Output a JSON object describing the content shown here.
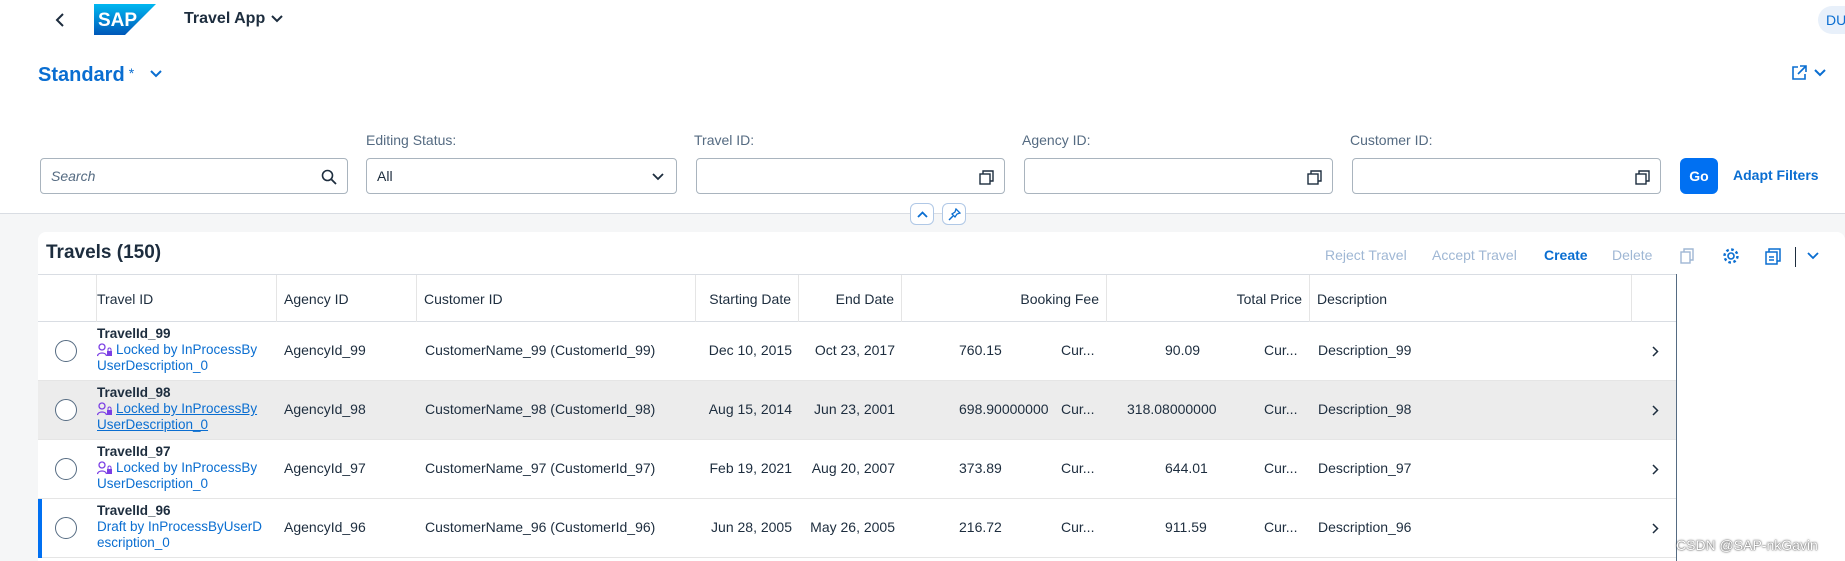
{
  "shell": {
    "app_title": "Travel App",
    "avatar_initials": "DU"
  },
  "header": {
    "variant_name": "Standard",
    "variant_modified": "*"
  },
  "filters": {
    "search_placeholder": "Search",
    "editing_status_label": "Editing Status:",
    "editing_status_value": "All",
    "travel_id_label": "Travel ID:",
    "agency_id_label": "Agency ID:",
    "customer_id_label": "Customer ID:",
    "go_label": "Go",
    "adapt_label": "Adapt Filters"
  },
  "table": {
    "title": "Travels (150)",
    "toolbar": {
      "reject": "Reject Travel",
      "accept": "Accept Travel",
      "create": "Create",
      "delete": "Delete"
    },
    "columns": [
      "Travel ID",
      "Agency ID",
      "Customer ID",
      "Starting Date",
      "End Date",
      "Booking Fee",
      "Total Price",
      "Description"
    ],
    "rows": [
      {
        "travel_id": "TravelId_99",
        "status_line1": "Locked by InProcessBy",
        "status_line2": "UserDescription_0",
        "agency": "AgencyId_99",
        "customer": "CustomerName_99 (CustomerId_99)",
        "start": "Dec 10, 2015",
        "end": "Oct 23, 2017",
        "fee": "760.15",
        "fee_cur": "Cur...",
        "total": "90.09",
        "total_cur": "Cur...",
        "description": "Description_99"
      },
      {
        "travel_id": "TravelId_98",
        "status_line1": "Locked by InProcessBy",
        "status_line2": "UserDescription_0",
        "agency": "AgencyId_98",
        "customer": "CustomerName_98 (CustomerId_98)",
        "start": "Aug 15, 2014",
        "end": "Jun 23, 2001",
        "fee": "698.90000000",
        "fee_cur": "Cur...",
        "total": "318.08000000",
        "total_cur": "Cur...",
        "description": "Description_98"
      },
      {
        "travel_id": "TravelId_97",
        "status_line1": "Locked by InProcessBy",
        "status_line2": "UserDescription_0",
        "agency": "AgencyId_97",
        "customer": "CustomerName_97 (CustomerId_97)",
        "start": "Feb 19, 2021",
        "end": "Aug 20, 2007",
        "fee": "373.89",
        "fee_cur": "Cur...",
        "total": "644.01",
        "total_cur": "Cur...",
        "description": "Description_97"
      },
      {
        "travel_id": "TravelId_96",
        "status_line1": "Draft by InProcessByUserD",
        "status_line2": "escription_0",
        "agency": "AgencyId_96",
        "customer": "CustomerName_96 (CustomerId_96)",
        "start": "Jun 28, 2005",
        "end": "May 26, 2005",
        "fee": "216.72",
        "fee_cur": "Cur...",
        "total": "911.59",
        "total_cur": "Cur...",
        "description": "Description_96"
      }
    ]
  },
  "watermark": "CSDN @SAP-nkGavin",
  "colors": {
    "brand": "#0a6ed1",
    "go_button": "#0070f2",
    "draft_indicator": "#0070f2",
    "lock_icon": "#7b3fe4"
  }
}
